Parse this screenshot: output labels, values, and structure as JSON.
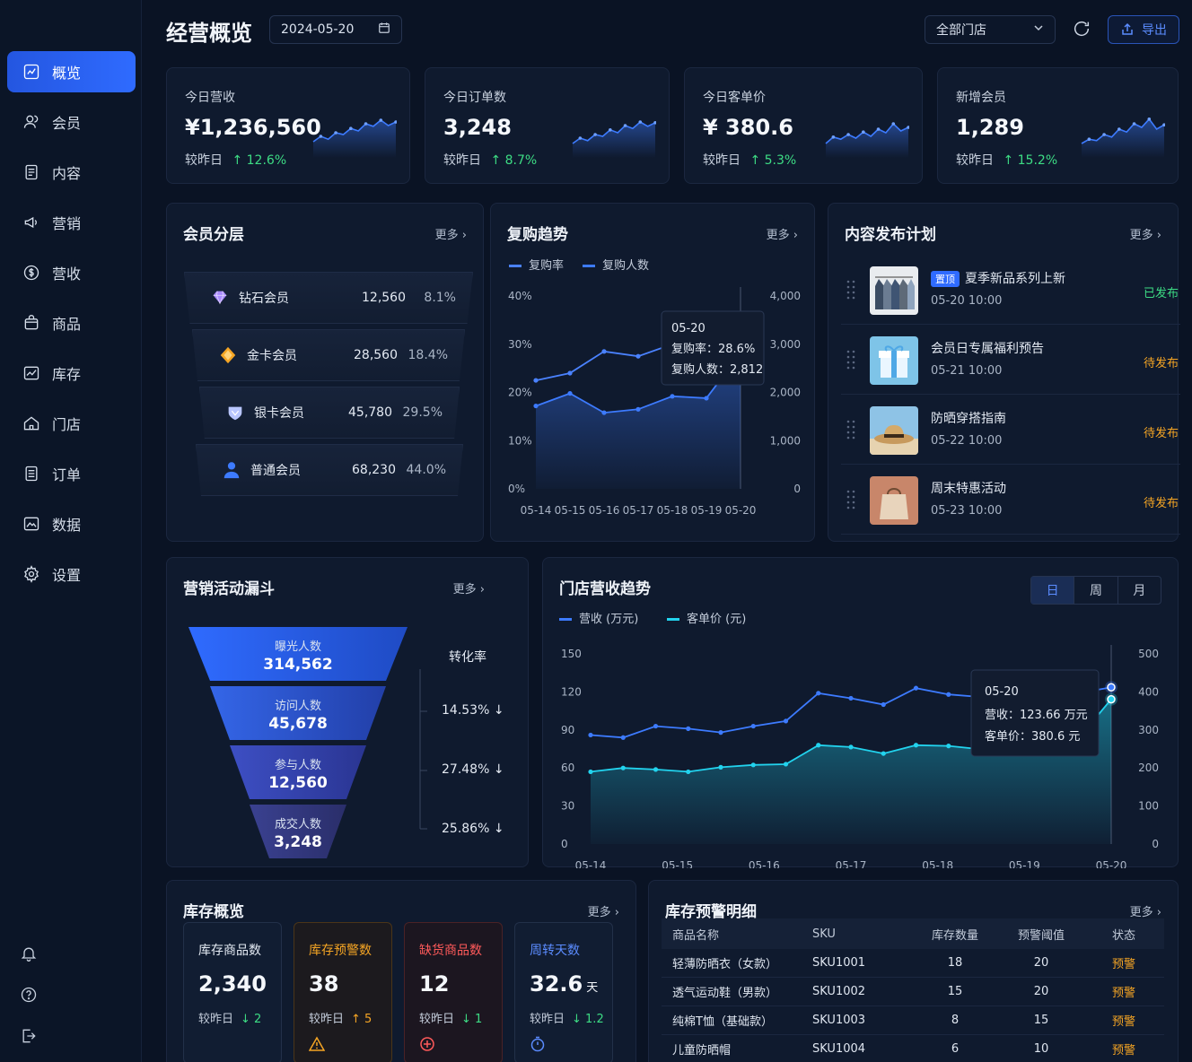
{
  "sidebar": {
    "items": [
      {
        "label": "概览",
        "icon": "chart-line-icon",
        "active": true
      },
      {
        "label": "会员",
        "icon": "users-icon"
      },
      {
        "label": "内容",
        "icon": "document-icon"
      },
      {
        "label": "营销",
        "icon": "megaphone-icon"
      },
      {
        "label": "营收",
        "icon": "dollar-icon"
      },
      {
        "label": "商品",
        "icon": "bag-icon"
      },
      {
        "label": "库存",
        "icon": "stock-chart-icon"
      },
      {
        "label": "门店",
        "icon": "home-icon"
      },
      {
        "label": "订单",
        "icon": "list-icon"
      },
      {
        "label": "数据",
        "icon": "image-chart-icon"
      },
      {
        "label": "设置",
        "icon": "gear-icon"
      }
    ],
    "bottom": [
      "bell-icon",
      "help-icon",
      "logout-icon"
    ]
  },
  "header": {
    "title": "经营概览",
    "date": "2024-05-20",
    "store": "全部门店",
    "export_label": "导出"
  },
  "kpis": [
    {
      "label": "今日营收",
      "value": "¥1,236,560",
      "cmp_label": "较昨日",
      "delta": "12.6%",
      "trend": [
        0.35,
        0.5,
        0.42,
        0.6,
        0.55,
        0.72,
        0.65,
        0.85,
        0.78,
        0.95,
        0.8,
        0.9
      ]
    },
    {
      "label": "今日订单数",
      "value": "3,248",
      "cmp_label": "较昨日",
      "delta": "8.7%",
      "trend": [
        0.3,
        0.45,
        0.38,
        0.55,
        0.5,
        0.68,
        0.6,
        0.8,
        0.72,
        0.9,
        0.78,
        0.88
      ]
    },
    {
      "label": "今日客单价",
      "value": "¥ 380.6",
      "cmp_label": "较昨日",
      "delta": "5.3%",
      "trend": [
        0.3,
        0.48,
        0.42,
        0.55,
        0.45,
        0.62,
        0.5,
        0.7,
        0.6,
        0.85,
        0.65,
        0.75
      ]
    },
    {
      "label": "新增会员",
      "value": "1,289",
      "cmp_label": "较昨日",
      "delta": "15.2%",
      "trend": [
        0.3,
        0.42,
        0.38,
        0.55,
        0.48,
        0.7,
        0.62,
        0.85,
        0.75,
        0.98,
        0.7,
        0.82
      ]
    }
  ],
  "members": {
    "title": "会员分层",
    "more": "更多",
    "tiers": [
      {
        "name": "钻石会员",
        "count": "12,560",
        "pct": "8.1%",
        "color": "#a98bff"
      },
      {
        "name": "金卡会员",
        "count": "28,560",
        "pct": "18.4%",
        "color": "#f5a524"
      },
      {
        "name": "银卡会员",
        "count": "45,780",
        "pct": "29.5%",
        "color": "#b9c6ff"
      },
      {
        "name": "普通会员",
        "count": "68,230",
        "pct": "44.0%",
        "color": "#3d7bff"
      }
    ]
  },
  "repurchase": {
    "title": "复购趋势",
    "more": "更多",
    "tooltip": {
      "date": "05-20",
      "rate": "复购率：28.6%",
      "people": "复购人数：2,812"
    }
  },
  "content_plan": {
    "title": "内容发布计划",
    "more": "更多",
    "items": [
      {
        "tag": "置顶",
        "title": "夏季新品系列上新",
        "time": "05-20 10:00",
        "status": "已发布",
        "status_color": "#3ddc84",
        "thumb": "clothes-rack"
      },
      {
        "tag": "",
        "title": "会员日专属福利预告",
        "time": "05-21 10:00",
        "status": "待发布",
        "status_color": "#f5a524",
        "thumb": "gift-box"
      },
      {
        "tag": "",
        "title": "防晒穿搭指南",
        "time": "05-22 10:00",
        "status": "待发布",
        "status_color": "#f5a524",
        "thumb": "sun-hat"
      },
      {
        "tag": "",
        "title": "周末特惠活动",
        "time": "05-23 10:00",
        "status": "待发布",
        "status_color": "#f5a524",
        "thumb": "shopping-bag"
      }
    ]
  },
  "funnel": {
    "title": "营销活动漏斗",
    "more": "更多",
    "conv_title": "转化率",
    "stages": [
      {
        "label": "曝光人数",
        "value": "314,562"
      },
      {
        "label": "访问人数",
        "value": "45,678"
      },
      {
        "label": "参与人数",
        "value": "12,560"
      },
      {
        "label": "成交人数",
        "value": "3,248"
      }
    ],
    "rates": [
      "14.53% ↓",
      "27.48% ↓",
      "25.86% ↓"
    ]
  },
  "store_trend": {
    "title": "门店营收趋势",
    "tabs": [
      "日",
      "周",
      "月"
    ],
    "tooltip": {
      "date": "05-20",
      "revenue": "营收：123.66 万元",
      "price": "客单价：380.6 元"
    }
  },
  "inventory": {
    "title": "库存概览",
    "more": "更多",
    "boxes": [
      {
        "label": "库存商品数",
        "value": "2,340",
        "unit": "",
        "cmp": "较昨日",
        "delta": "↓ 2",
        "label_color": "#e4eaf3",
        "delta_color": "#3ddc84",
        "border": "#223049",
        "bg": "#111d32",
        "icon": ""
      },
      {
        "label": "库存预警数",
        "value": "38",
        "unit": "",
        "cmp": "较昨日",
        "delta": "↑ 5",
        "label_color": "#f5a524",
        "delta_color": "#f5a524",
        "border": "#4a3518",
        "bg": "#1c1a1e",
        "icon": "warning-icon"
      },
      {
        "label": "缺货商品数",
        "value": "12",
        "unit": "",
        "cmp": "较昨日",
        "delta": "↓ 1",
        "label_color": "#ff5a5a",
        "delta_color": "#3ddc84",
        "border": "#4a2226",
        "bg": "#1c1620",
        "icon": "target-icon"
      },
      {
        "label": "周转天数",
        "value": "32.6",
        "unit": "天",
        "cmp": "较昨日",
        "delta": "↓ 1.2",
        "label_color": "#5b8cff",
        "delta_color": "#3ddc84",
        "border": "#223049",
        "bg": "#111d32",
        "icon": "timer-icon"
      }
    ]
  },
  "stock_alert": {
    "title": "库存预警明细",
    "more": "更多",
    "columns": [
      "商品名称",
      "SKU",
      "库存数量",
      "预警阈值",
      "状态"
    ],
    "rows": [
      [
        "轻薄防晒衣（女款）",
        "SKU1001",
        "18",
        "20",
        "预警"
      ],
      [
        "透气运动鞋（男款）",
        "SKU1002",
        "15",
        "20",
        "预警"
      ],
      [
        "纯棉T恤（基础款）",
        "SKU1003",
        "8",
        "15",
        "预警"
      ],
      [
        "儿童防晒帽",
        "SKU1004",
        "6",
        "10",
        "预警"
      ]
    ]
  },
  "chart_data": [
    {
      "type": "line",
      "title": "复购趋势",
      "categories": [
        "05-14",
        "05-15",
        "05-16",
        "05-17",
        "05-18",
        "05-19",
        "05-20"
      ],
      "series": [
        {
          "name": "复购率",
          "axis": "left",
          "values": [
            22.5,
            24,
            28.5,
            27.5,
            30,
            29.5,
            28.6
          ],
          "color": "#3d7bff"
        },
        {
          "name": "复购人数",
          "axis": "right",
          "values": [
            1720,
            1980,
            1580,
            1650,
            1920,
            1880,
            2812
          ],
          "color": "#3d7bff"
        }
      ],
      "legend": [
        "复购率",
        "复购人数"
      ],
      "y_left": {
        "ticks": [
          "0%",
          "10%",
          "20%",
          "30%",
          "40%"
        ],
        "range": [
          0,
          40
        ]
      },
      "y_right": {
        "ticks": [
          "0",
          "1,000",
          "2,000",
          "3,000",
          "4,000"
        ],
        "range": [
          0,
          4000
        ]
      }
    },
    {
      "type": "line",
      "title": "门店营收趋势",
      "categories": [
        "05-14",
        "05-15",
        "05-16",
        "05-17",
        "05-18",
        "05-19",
        "05-20"
      ],
      "series": [
        {
          "name": "营收 (万元)",
          "axis": "left",
          "values": [
            86,
            84,
            93,
            91,
            88,
            93,
            97,
            119,
            115,
            110,
            123,
            118,
            116,
            122,
            121,
            119,
            123.66
          ],
          "color": "#3d7bff"
        },
        {
          "name": "客单价 (元)",
          "axis": "right",
          "values": [
            190,
            200,
            196,
            190,
            202,
            208,
            210,
            260,
            255,
            238,
            260,
            258,
            249,
            268,
            272,
            278,
            380.6
          ],
          "color": "#22d3ee"
        }
      ],
      "legend": [
        "营收 (万元)",
        "客单价 (元)"
      ],
      "y_left": {
        "ticks": [
          "0",
          "30",
          "60",
          "90",
          "120",
          "150"
        ],
        "range": [
          0,
          150
        ]
      },
      "y_right": {
        "ticks": [
          "0",
          "100",
          "200",
          "300",
          "400",
          "500"
        ],
        "range": [
          0,
          500
        ]
      }
    }
  ]
}
